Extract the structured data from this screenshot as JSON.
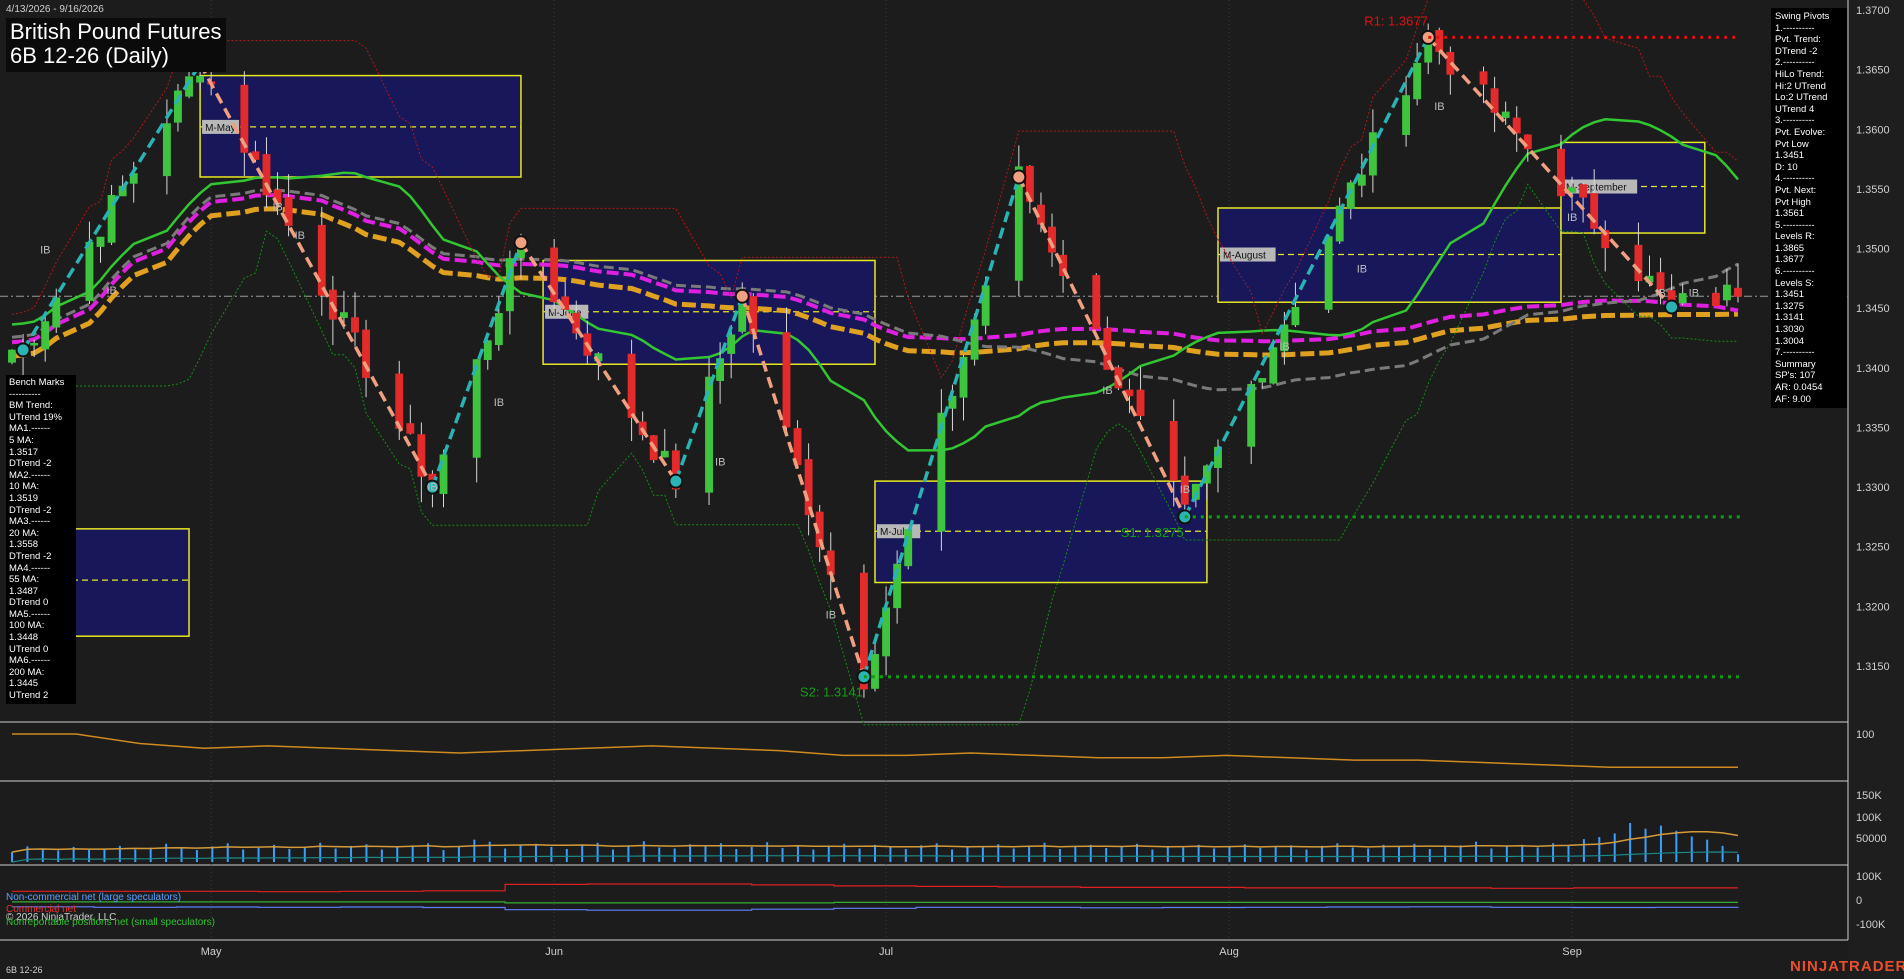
{
  "header": {
    "date_range": "4/13/2026 - 9/16/2026",
    "title_line1": "British Pound Futures",
    "title_line2": "6B 12-26 (Daily)"
  },
  "footer": {
    "symbol": "6B 12-26",
    "copyright": "© 2026 NinjaTrader, LLC",
    "brand": "NINJATRADER"
  },
  "bench_marks": [
    "Bench Marks",
    "----------",
    "BM Trend:",
    "UTrend 19%",
    "MA1.------",
    "5 MA:",
    "1.3517",
    "DTrend -2",
    "MA2.------",
    "10 MA:",
    "1.3519",
    "DTrend -2",
    "MA3.------",
    "20 MA:",
    "1.3558",
    "DTrend -2",
    "MA4.------",
    "55 MA:",
    "1.3487",
    "DTrend 0",
    "MA5.------",
    "100 MA:",
    "1.3448",
    "UTrend 0",
    "MA6.------",
    "200 MA:",
    "1.3445",
    "UTrend 2"
  ],
  "swing_pivots": [
    "Swing Pivots",
    "1.----------",
    "Pvt. Trend:",
    "DTrend -2",
    "2.----------",
    "HiLo Trend:",
    "Hi:2 UTrend",
    "Lo:2 UTrend",
    "UTrend 4",
    "3.----------",
    "Pvt. Evolve:",
    "Pvt Low",
    "1.3451",
    "D: 10",
    "4.----------",
    "Pvt. Next:",
    "Pvt High",
    "1.3561",
    "5.----------",
    "Levels R:",
    "1.3865",
    "1.3677",
    "6.----------",
    "Levels S:",
    "1.3451",
    "1.3275",
    "1.3141",
    "1.3030",
    "1.3004",
    "7.----------",
    "Summary",
    "SP's: 107",
    "AR: 0.0454",
    "AF: 9.00"
  ],
  "legend": {
    "noncommercial": "Non-commercial net (large speculators)",
    "commercial": "Commercial net",
    "nonreportable": "Nonreportable positions net (small speculators)"
  },
  "colors": {
    "background": "#1e1e1e",
    "bull_candle": "#3ec43e",
    "bear_candle": "#e32b2b",
    "swing_up": "#2ab3b3",
    "swing_down": "#f0a080",
    "ma20": "#33c633",
    "ma55": "#7a7a7a",
    "ma100": "#e020e0",
    "ma200": "#e0a020",
    "level_r": "#e01010",
    "level_s": "#10a010",
    "monthly_box": "#17175a",
    "monthly_box_border": "#e8e820",
    "volume": "#3aa0ff",
    "brand": "#e8502d"
  },
  "chart_data": [
    {
      "type": "candlestick",
      "title": "British Pound Futures 6B 12-26 (Daily)",
      "x_axis": {
        "type": "date",
        "range": [
          "2026-04-13",
          "2026-09-16"
        ],
        "tick_labels": [
          "May",
          "Jun",
          "Jul",
          "Aug",
          "Sep"
        ],
        "tick_dates": [
          "2026-05-01",
          "2026-06-01",
          "2026-07-01",
          "2026-08-01",
          "2026-09-01"
        ]
      },
      "y_axis": {
        "position": "right",
        "range": [
          1.3095,
          1.3705
        ],
        "ticks": [
          "1.3150",
          "1.3200",
          "1.3250",
          "1.3300",
          "1.3350",
          "1.3400",
          "1.3450",
          "1.3500",
          "1.3550",
          "1.3600",
          "1.3650",
          "1.3700"
        ]
      },
      "current_price": 1.346,
      "swing_pivots": [
        {
          "date": "2026-04-14",
          "price": 1.3415,
          "type": "low"
        },
        {
          "date": "2026-04-30",
          "price": 1.3655,
          "type": "high"
        },
        {
          "date": "2026-05-21",
          "price": 1.33,
          "type": "low"
        },
        {
          "date": "2026-05-29",
          "price": 1.3505,
          "type": "high"
        },
        {
          "date": "2026-06-12",
          "price": 1.3305,
          "type": "low"
        },
        {
          "date": "2026-06-18",
          "price": 1.346,
          "type": "high"
        },
        {
          "date": "2026-06-29",
          "price": 1.3141,
          "type": "low"
        },
        {
          "date": "2026-07-13",
          "price": 1.356,
          "type": "high"
        },
        {
          "date": "2026-07-28",
          "price": 1.3275,
          "type": "low"
        },
        {
          "date": "2026-08-19",
          "price": 1.3677,
          "type": "high"
        },
        {
          "date": "2026-09-10",
          "price": 1.3451,
          "type": "low"
        }
      ],
      "levels": [
        {
          "label": "R1: 1.3677",
          "price": 1.3677,
          "kind": "resistance"
        },
        {
          "label": "S1: 1.3275",
          "price": 1.3275,
          "kind": "support"
        },
        {
          "label": "S2: 1.3141",
          "price": 1.3141,
          "kind": "support"
        }
      ],
      "monthly_boxes": [
        {
          "label": "M-May",
          "start": "2026-04-30",
          "end": "2026-05-29",
          "high": 1.3645,
          "low": 1.356,
          "mid": 1.3602
        },
        {
          "label": "M-June",
          "start": "2026-05-31",
          "end": "2026-06-30",
          "high": 1.349,
          "low": 1.3403,
          "mid": 1.3447
        },
        {
          "label": "M-July",
          "start": "2026-06-30",
          "end": "2026-07-30",
          "high": 1.3305,
          "low": 1.322,
          "mid": 1.3263
        },
        {
          "label": "M-August",
          "start": "2026-07-31",
          "end": "2026-08-31",
          "high": 1.3534,
          "low": 1.3455,
          "mid": 1.3495
        },
        {
          "label": "M-September",
          "start": "2026-08-31",
          "end": "2026-09-13",
          "high": 1.3589,
          "low": 1.3513,
          "mid": 1.3552
        },
        {
          "label": "",
          "start": "2026-04-13",
          "end": "2026-04-29",
          "high": 1.3265,
          "low": 1.3175,
          "mid": 1.3222
        }
      ],
      "ib_markers": [
        "IB",
        "IB",
        "IB",
        "IB",
        "IB",
        "IB",
        "IB",
        "IB",
        "IB",
        "IB",
        "IB",
        "IB",
        "IB",
        "IB",
        "IB",
        "IB"
      ],
      "moving_averages": [
        {
          "name": "20 MA",
          "last": 1.3558
        },
        {
          "name": "55 MA",
          "last": 1.3487
        },
        {
          "name": "100 MA",
          "last": 1.3448
        },
        {
          "name": "200 MA",
          "last": 1.3445
        }
      ]
    },
    {
      "type": "line",
      "panel": "oscillator",
      "y_ticks": [
        "100"
      ],
      "values": [
        100,
        100,
        96,
        94,
        95,
        94,
        93,
        92,
        93,
        94,
        95,
        94,
        93,
        91,
        91,
        92,
        91,
        90,
        90,
        91,
        90,
        89,
        89,
        88,
        87,
        86,
        86,
        86
      ]
    },
    {
      "type": "bar",
      "panel": "volume",
      "y_ticks": [
        "50000",
        "100K",
        "150K"
      ],
      "values": [
        38000,
        60000,
        52000,
        44000,
        58000,
        46000,
        50000,
        62000,
        48000,
        55000,
        70000,
        52000,
        46000,
        60000,
        72000,
        48000,
        54000,
        66000,
        50000,
        58000,
        74000,
        52000,
        62000,
        68000,
        48000,
        58000,
        64000,
        72000,
        46000,
        60000,
        86000,
        78000,
        52000,
        64000,
        70000,
        58000,
        50000,
        66000,
        74000,
        48000,
        62000,
        80000,
        56000,
        52000,
        68000,
        60000,
        72000,
        50000,
        58000,
        76000,
        54000,
        64000,
        48000,
        60000,
        70000,
        52000,
        66000,
        58000,
        50000,
        64000,
        72000,
        48000,
        60000,
        56000,
        68000,
        52000,
        62000,
        74000,
        50000,
        58000,
        66000,
        54000,
        60000,
        70000,
        48000,
        62000,
        56000,
        66000,
        52000,
        60000,
        68000,
        54000,
        58000,
        64000,
        48000,
        62000,
        72000,
        56000,
        52000,
        66000,
        60000,
        70000,
        50000,
        58000,
        64000,
        78000,
        52000,
        60000,
        66000,
        56000,
        72000,
        62000,
        88000,
        96000,
        110000,
        150000,
        128000,
        140000,
        120000,
        98000,
        86000,
        62000,
        30000
      ]
    },
    {
      "type": "line",
      "panel": "cot",
      "y_ticks": [
        "100K",
        "0",
        "-100K"
      ],
      "series": [
        {
          "name": "Non-commercial net (large speculators)",
          "values": [
            -28000,
            -30000,
            -29000,
            -30000,
            -29000,
            -31000,
            -40000,
            -42000,
            -42000,
            -38000,
            -34000,
            -30000,
            -30000,
            -32000,
            -31000,
            -30000,
            -29000,
            -28000,
            -30000,
            -31000,
            -30000,
            -29000
          ]
        },
        {
          "name": "Commercial net",
          "values": [
            36000,
            36000,
            36000,
            34000,
            36000,
            38000,
            64000,
            66000,
            66000,
            62000,
            58000,
            56000,
            54000,
            52000,
            52000,
            50000,
            50000,
            50000,
            48000,
            50000,
            50000,
            50000
          ]
        },
        {
          "name": "Nonreportable positions net (small speculators)",
          "values": [
            -8000,
            -8000,
            -8000,
            -8000,
            -8000,
            -8000,
            -12000,
            -12000,
            -12000,
            -12000,
            -10000,
            -10000,
            -10000,
            -10000,
            -10000,
            -10000,
            -10000,
            -10000,
            -10000,
            -10000,
            -10000,
            -10000
          ]
        }
      ]
    }
  ]
}
